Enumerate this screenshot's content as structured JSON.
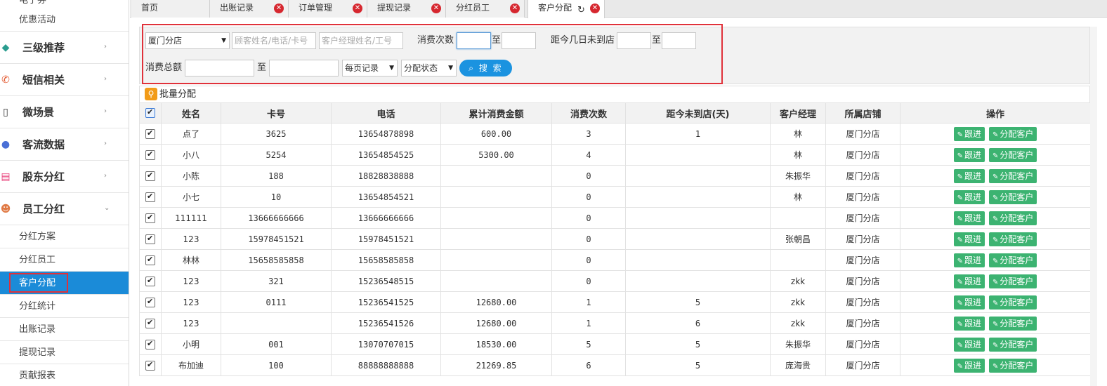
{
  "sidebar": {
    "top_cut_item": "电子券",
    "promo_item": "优惠活动",
    "sections": [
      {
        "label": "三级推荐",
        "icon": "layers-icon"
      },
      {
        "label": "短信相关",
        "icon": "phone-icon"
      },
      {
        "label": "微场景",
        "icon": "mobile-icon"
      },
      {
        "label": "客流数据",
        "icon": "chart-icon"
      },
      {
        "label": "股东分红",
        "icon": "document-icon"
      },
      {
        "label": "员工分红",
        "icon": "user-icon"
      }
    ],
    "sub_items": [
      "分红方案",
      "分红员工",
      "客户分配",
      "分红统计",
      "出账记录",
      "提现记录",
      "贡献报表"
    ],
    "active_sub": "客户分配"
  },
  "tabs": [
    {
      "label": "首页"
    },
    {
      "label": "出账记录"
    },
    {
      "label": "订单管理"
    },
    {
      "label": "提现记录"
    },
    {
      "label": "分红员工"
    },
    {
      "label": "客户分配"
    }
  ],
  "filter": {
    "store_select": "厦门分店",
    "customer_placeholder": "顾客姓名/电话/卡号",
    "manager_placeholder": "客户经理姓名/工号",
    "visits_label": "消费次数",
    "to1": "至",
    "days_label": "距今几日未到店",
    "to2": "至",
    "amount_label": "消费总额",
    "to3": "至",
    "per_page_select": "每页记录",
    "status_select": "分配状态",
    "search_button": "搜 索"
  },
  "batch_assign_label": "批量分配",
  "table": {
    "headers": [
      "姓名",
      "卡号",
      "电话",
      "累计消费金额",
      "消费次数",
      "距今未到店(天)",
      "客户经理",
      "所属店铺",
      "操作"
    ],
    "follow_label": "跟进",
    "assign_label": "分配客户",
    "rows": [
      [
        "点了",
        "3625",
        "13654878898",
        "600.00",
        "3",
        "1",
        "林",
        "厦门分店"
      ],
      [
        "小八",
        "5254",
        "13654854525",
        "5300.00",
        "4",
        "",
        "林",
        "厦门分店"
      ],
      [
        "小陈",
        "188",
        "18828838888",
        "",
        "0",
        "",
        "朱振华",
        "厦门分店"
      ],
      [
        "小七",
        "10",
        "13654854521",
        "",
        "0",
        "",
        "林",
        "厦门分店"
      ],
      [
        "111111",
        "13666666666",
        "13666666666",
        "",
        "0",
        "",
        "",
        "厦门分店"
      ],
      [
        "123",
        "15978451521",
        "15978451521",
        "",
        "0",
        "",
        "张朝昌",
        "厦门分店"
      ],
      [
        "林林",
        "15658585858",
        "15658585858",
        "",
        "0",
        "",
        "",
        "厦门分店"
      ],
      [
        "123",
        "321",
        "15236548515",
        "",
        "0",
        "",
        "zkk",
        "厦门分店"
      ],
      [
        "123",
        "0111",
        "15236541525",
        "12680.00",
        "1",
        "5",
        "zkk",
        "厦门分店"
      ],
      [
        "123",
        "",
        "15236541526",
        "12680.00",
        "1",
        "6",
        "zkk",
        "厦门分店"
      ],
      [
        "小明",
        "001",
        "13070707015",
        "18530.00",
        "5",
        "5",
        "朱振华",
        "厦门分店"
      ],
      [
        "布加迪",
        "100",
        "88888888888",
        "21269.85",
        "6",
        "5",
        "庞海贵",
        "厦门分店"
      ]
    ]
  },
  "colors": {
    "active_sidebar": "#1b8bd8",
    "action_green": "#3cb371",
    "search_blue": "#1b93e0",
    "highlight_red": "#e0313a",
    "close_red": "#d6272f"
  }
}
